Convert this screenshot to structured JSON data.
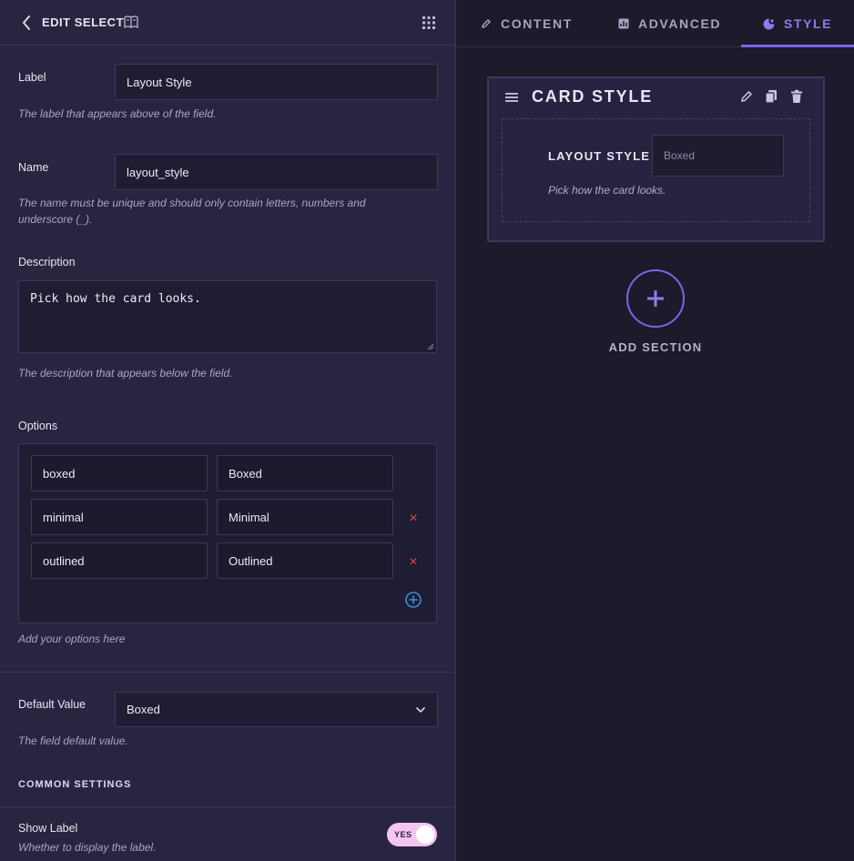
{
  "header": {
    "title": "EDIT SELECT"
  },
  "fields": {
    "label": {
      "label": "Label",
      "value": "Layout Style",
      "help": "The label that appears above of the field."
    },
    "name": {
      "label": "Name",
      "value": "layout_style",
      "help_line1": "The name must be unique and should only contain letters, numbers and",
      "help_line2": "underscore (_)."
    },
    "description": {
      "label": "Description",
      "value": "Pick how the card looks.",
      "help": "The description that appears below the field."
    },
    "options": {
      "label": "Options",
      "rows": [
        {
          "value": "boxed",
          "text": "Boxed"
        },
        {
          "value": "minimal",
          "text": "Minimal"
        },
        {
          "value": "outlined",
          "text": "Outlined"
        }
      ],
      "remove_glyph": "×",
      "help": "Add your options here"
    },
    "default_value": {
      "label": "Default Value",
      "value": "Boxed",
      "help": "The field default value."
    }
  },
  "common_settings": {
    "heading": "COMMON SETTINGS",
    "show_label": {
      "label": "Show Label",
      "help": "Whether to display the label.",
      "toggle_text": "YES",
      "enabled": true
    }
  },
  "tabs": [
    {
      "label": "CONTENT",
      "icon": "pencil-icon",
      "active": false
    },
    {
      "label": "ADVANCED",
      "icon": "advanced-icon",
      "active": false
    },
    {
      "label": "STYLE",
      "icon": "palette-icon",
      "active": true
    }
  ],
  "card": {
    "title": "CARD STYLE",
    "preview": {
      "label": "LAYOUT STYLE",
      "selected": "Boxed",
      "help": "Pick how the card looks."
    }
  },
  "add_section": {
    "label": "ADD SECTION"
  },
  "colors": {
    "accent": "#7a66e8",
    "remove": "#e5484d",
    "add_option": "#3b8ed8",
    "toggle_on": "#f3c6f2"
  }
}
